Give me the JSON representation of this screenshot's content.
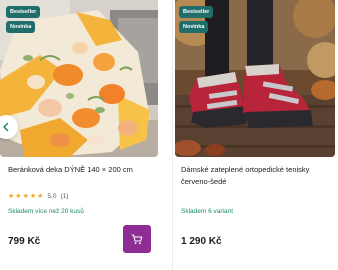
{
  "products": [
    {
      "badges": [
        "Bestseller",
        "Novinka"
      ],
      "title": "Beránková deka DÝNĚ 140 × 200 cm",
      "rating": 5,
      "rating_text": "5,0",
      "review_count": "(1)",
      "stock": "Skladem více než 20 kusů",
      "price": "799 Kč"
    },
    {
      "badges": [
        "Bestseller",
        "Novinka"
      ],
      "title": "Dámské zateplené ortopedické tenisky červeno-šedé",
      "stock": "Skladem 6 variant",
      "price": "1 290 Kč"
    }
  ],
  "colors": {
    "badge": "#1f6e6b",
    "stock": "#1c8a6a",
    "cart_button": "#8e2e95",
    "star": "#f5a623"
  },
  "icons": {
    "prev": "chevron-left-icon",
    "cart": "cart-icon",
    "star": "star-icon"
  }
}
